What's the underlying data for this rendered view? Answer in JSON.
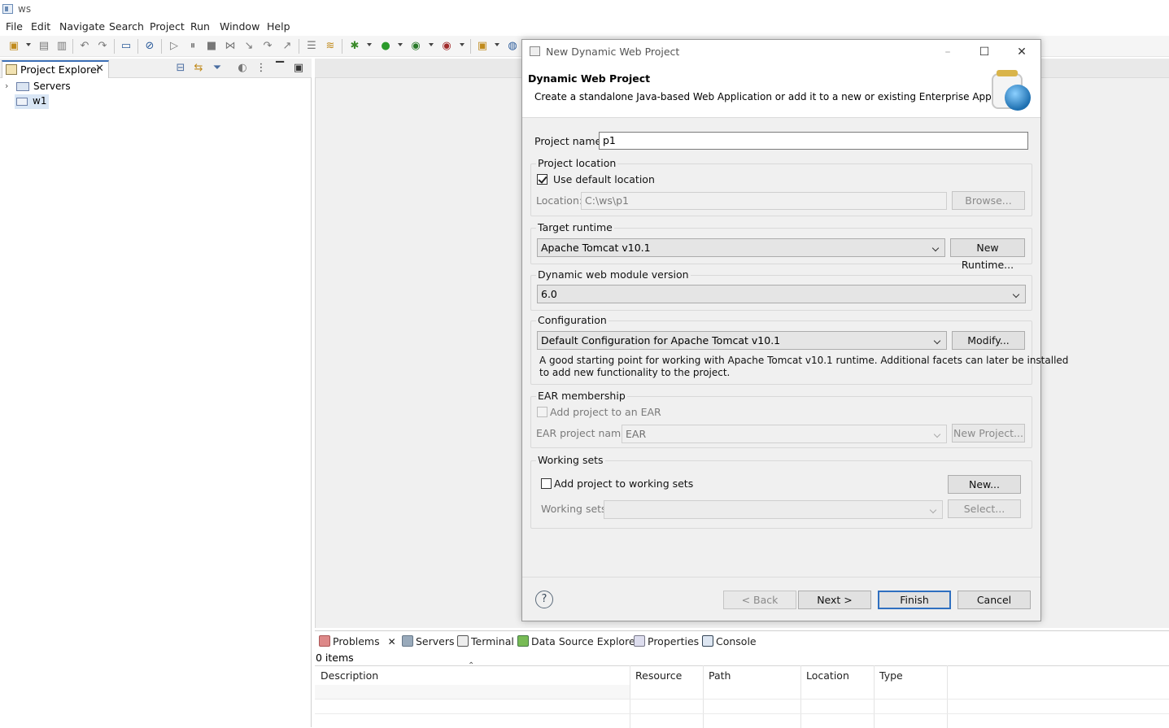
{
  "window": {
    "title": "ws"
  },
  "menu": [
    "File",
    "Edit",
    "Navigate",
    "Search",
    "Project",
    "Run",
    "Window",
    "Help"
  ],
  "explorer": {
    "tab_label": "Project Explorer",
    "items": [
      {
        "label": "Servers"
      },
      {
        "label": "w1"
      }
    ]
  },
  "bottom_panel": {
    "tabs": [
      "Problems",
      "Servers",
      "Terminal",
      "Data Source Explorer",
      "Properties",
      "Console"
    ],
    "status": "0 items",
    "columns": [
      "Description",
      "Resource",
      "Path",
      "Location",
      "Type"
    ]
  },
  "dialog": {
    "title": "New Dynamic Web Project",
    "header_title": "Dynamic Web Project",
    "header_desc": "Create a standalone Java-based Web Application or add it to a new or existing Enterprise Application.",
    "project_name_label": "Project name:",
    "project_name_value": "p1",
    "location_group": "Project location",
    "use_default_label": "Use default location",
    "use_default_checked": true,
    "location_label": "Location:",
    "location_value": "C:\\ws\\p1",
    "browse_label": "Browse...",
    "runtime_group": "Target runtime",
    "runtime_value": "Apache Tomcat v10.1",
    "new_runtime_label": "New Runtime...",
    "module_group": "Dynamic web module version",
    "module_value": "6.0",
    "config_group": "Configuration",
    "config_value": "Default Configuration for Apache Tomcat v10.1",
    "modify_label": "Modify...",
    "config_desc_line1": "A good starting point for working with Apache Tomcat v10.1 runtime. Additional facets can later be installed",
    "config_desc_line2": "to add new functionality to the project.",
    "ear_group": "EAR membership",
    "add_ear_label": "Add project to an EAR",
    "ear_name_label": "EAR project name:",
    "ear_name_value": "EAR",
    "new_project_label": "New Project...",
    "ws_group": "Working sets",
    "add_ws_label": "Add project to working sets",
    "new_ws_label": "New...",
    "ws_label": "Working sets:",
    "select_label": "Select...",
    "back_label": "< Back",
    "next_label": "Next >",
    "finish_label": "Finish",
    "cancel_label": "Cancel",
    "help_icon": "?"
  }
}
